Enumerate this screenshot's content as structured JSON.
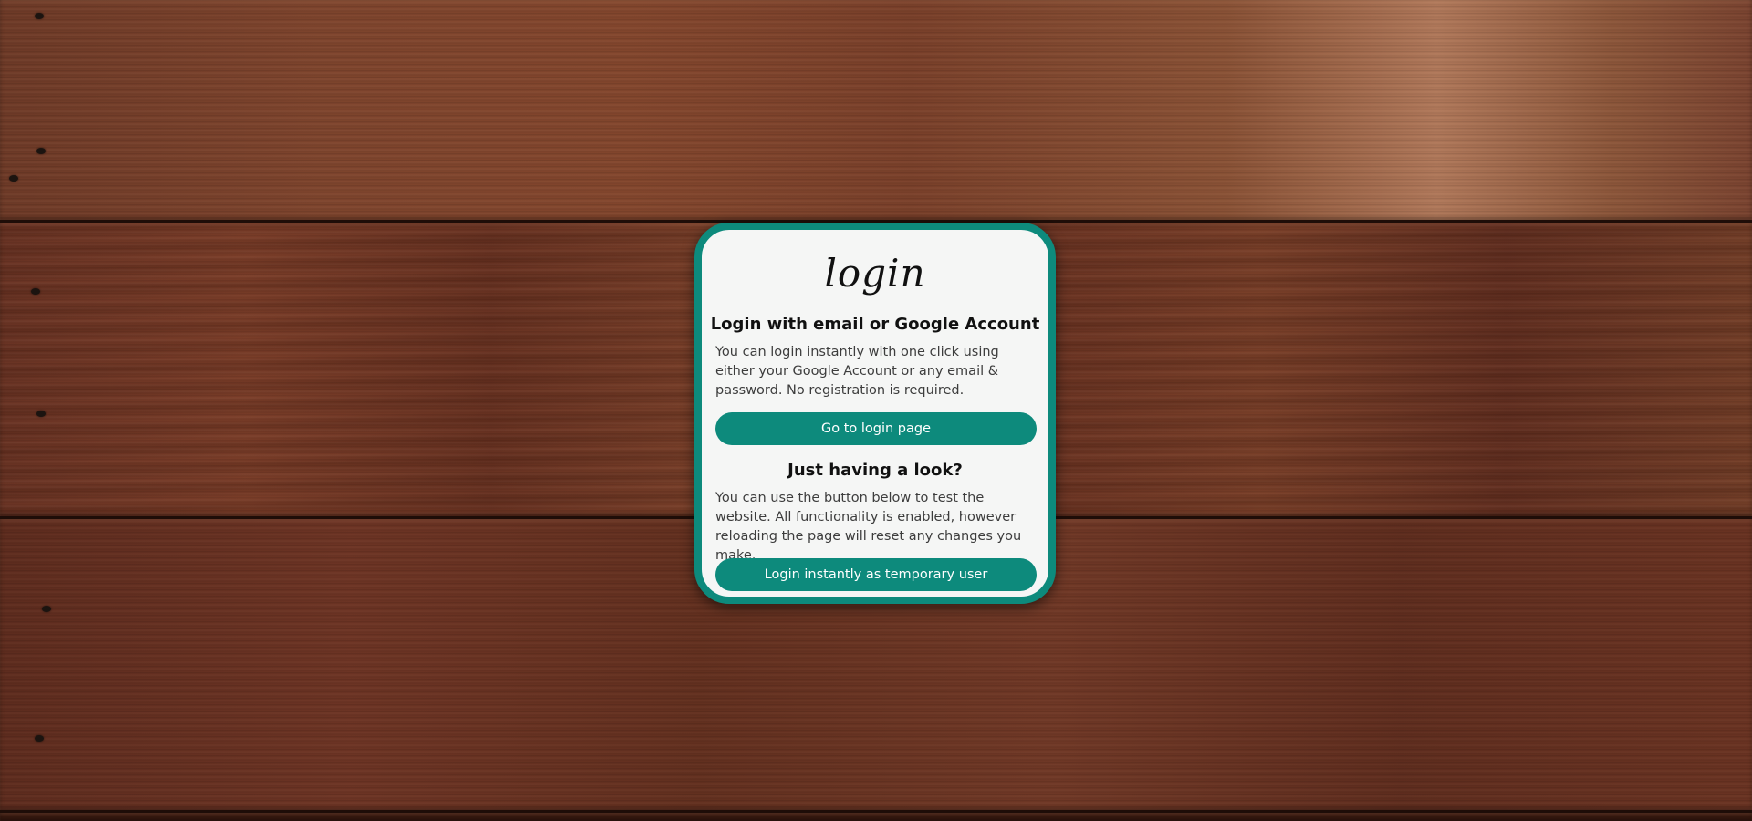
{
  "login_card": {
    "logo_text": "login",
    "email_section": {
      "heading": "Login with email or Google Account",
      "description": "You can login instantly with one click using either your Google Account or any email & password. No registration is required.",
      "button_label": "Go to login page"
    },
    "temporary_section": {
      "heading": "Just having a look?",
      "description": "You can use the button below to test the website. All functionality is enabled, however reloading the page will reset any changes you make.",
      "button_label": "Login instantly as temporary user"
    }
  },
  "colors": {
    "accent": "#0d8a7c",
    "card_background": "#f5f6f5",
    "wood_background": "#6e3a27"
  }
}
